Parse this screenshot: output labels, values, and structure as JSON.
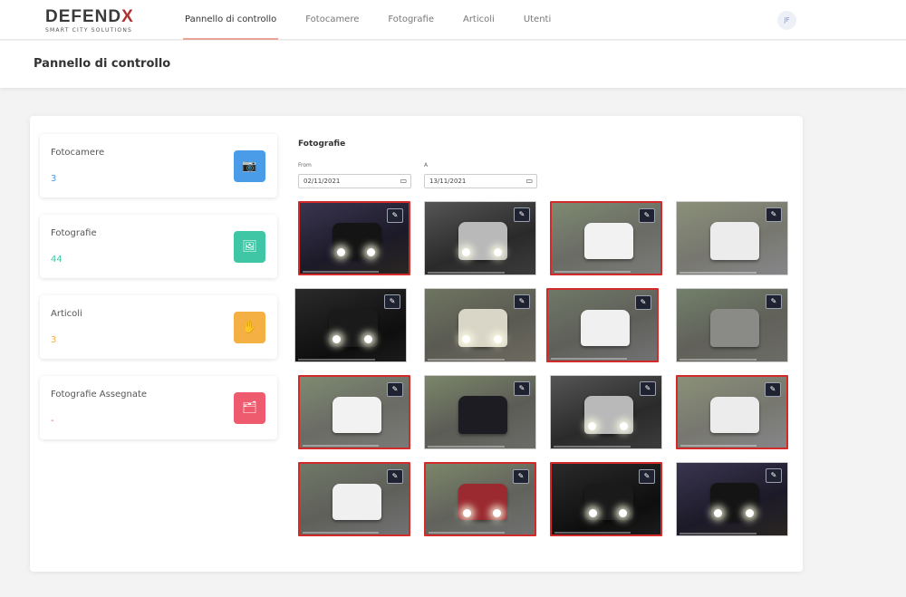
{
  "brand": {
    "name_start": "DEFEND",
    "name_end": "X",
    "tagline": "SMART CITY SOLUTIONS"
  },
  "nav": {
    "items": [
      {
        "label": "Pannello di controllo",
        "active": true
      },
      {
        "label": "Fotocamere",
        "active": false
      },
      {
        "label": "Fotografie",
        "active": false
      },
      {
        "label": "Articoli",
        "active": false
      },
      {
        "label": "Utenti",
        "active": false
      }
    ]
  },
  "user": {
    "initials": "JF"
  },
  "page": {
    "title": "Pannello di controllo"
  },
  "stats": [
    {
      "label": "Fotocamere",
      "value": "3",
      "color": "#4a9be8",
      "icon": "camera-icon",
      "glyph": "📷"
    },
    {
      "label": "Fotografie",
      "value": "44",
      "color": "#3ec6a5",
      "icon": "image-icon",
      "glyph": "🖼"
    },
    {
      "label": "Articoli",
      "value": "3",
      "color": "#f4b042",
      "icon": "hand-icon",
      "glyph": "✋"
    },
    {
      "label": "Fotografie Assegnate",
      "value": "-",
      "color": "#ee5a6e",
      "icon": "images-icon",
      "glyph": "🗂"
    }
  ],
  "photos": {
    "title": "Fotografie",
    "from_label": "From",
    "to_label": "A",
    "from_value": "02/11/2021",
    "to_value": "13/11/2021",
    "calendar_icon": "calendar-icon",
    "edit_icon": "pencil-icon",
    "edit_glyph": "✎",
    "flag_color": "#d42a2a",
    "items": [
      {
        "flagged": true,
        "tone": "night-color"
      },
      {
        "flagged": false,
        "tone": "night-ir"
      },
      {
        "flagged": true,
        "tone": "day-white-suv"
      },
      {
        "flagged": false,
        "tone": "day-white-car"
      },
      {
        "flagged": false,
        "tone": "night-headlights"
      },
      {
        "flagged": false,
        "tone": "day-van"
      },
      {
        "flagged": true,
        "tone": "day-white-van"
      },
      {
        "flagged": false,
        "tone": "day-truck"
      },
      {
        "flagged": true,
        "tone": "day-white-suv"
      },
      {
        "flagged": false,
        "tone": "day-dark-car"
      },
      {
        "flagged": false,
        "tone": "night-ir"
      },
      {
        "flagged": true,
        "tone": "day-white-car"
      },
      {
        "flagged": true,
        "tone": "day-white-van"
      },
      {
        "flagged": true,
        "tone": "day-red-car"
      },
      {
        "flagged": true,
        "tone": "night-headlights"
      },
      {
        "flagged": false,
        "tone": "night-color"
      }
    ]
  }
}
